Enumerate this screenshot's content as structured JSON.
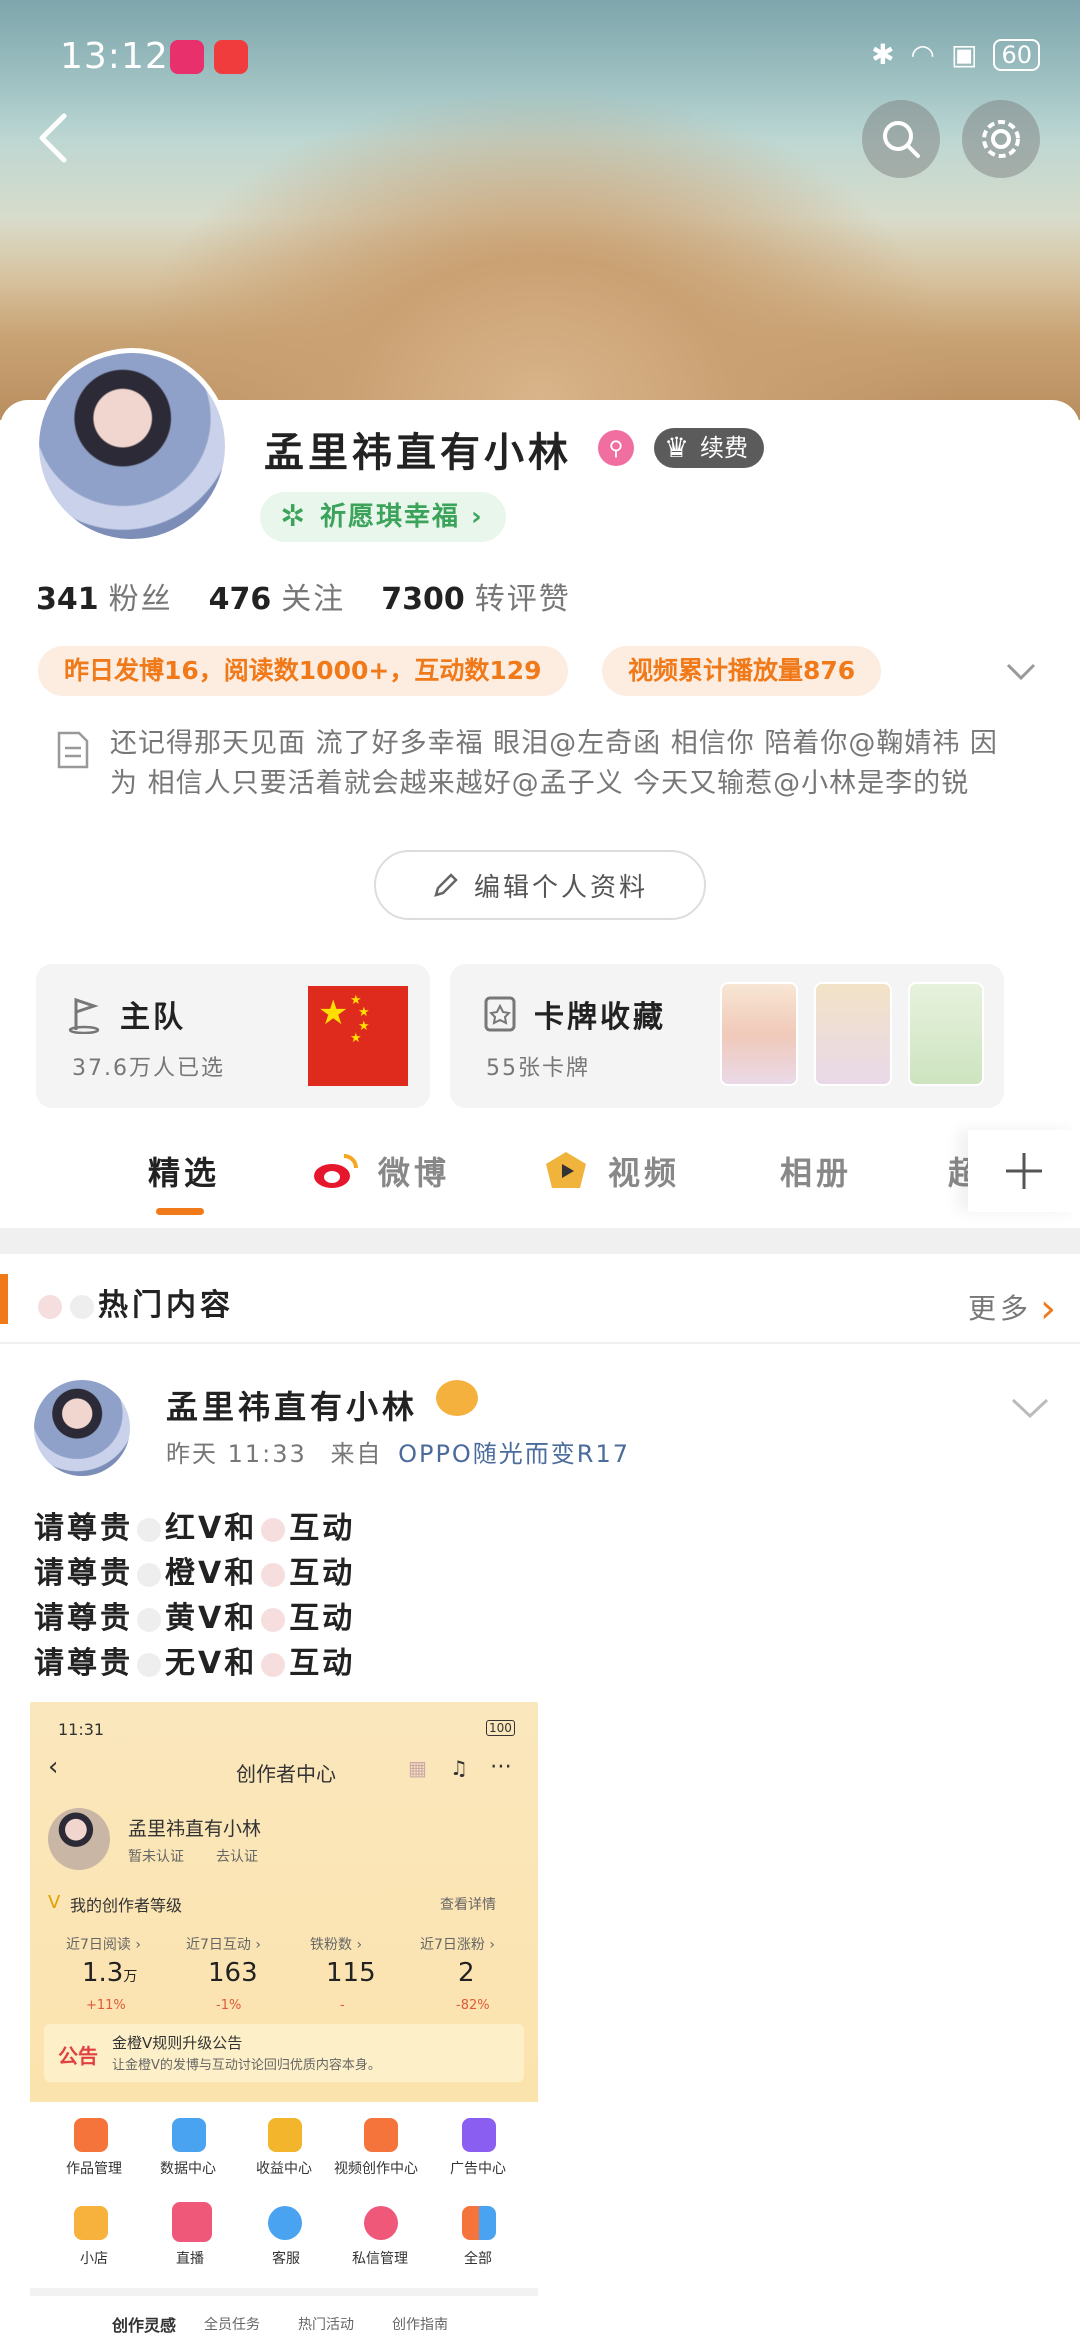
{
  "status_bar": {
    "time": "13:12",
    "battery": "60"
  },
  "profile": {
    "name": "孟里祎直有小林",
    "vip_label": "续费",
    "wish_label": "祈愿琪幸福 ›",
    "stats": [
      {
        "value": "341",
        "label": "粉丝"
      },
      {
        "value": "476",
        "label": "关注"
      },
      {
        "value": "7300",
        "label": "转评赞"
      }
    ],
    "pills": [
      "昨日发博16，阅读数1000+，互动数129",
      "视频累计播放量876"
    ],
    "bio": "还记得那天见面  流了好多幸福  眼泪@左奇函 相信你 陪着你@鞠婧祎 因为  相信人只要活着就会越来越好@孟子义 今天又输惹@小林是李的锐",
    "edit_label": "编辑个人资料"
  },
  "cards": {
    "team": {
      "title": "主队",
      "sub": "37.6万人已选"
    },
    "collection": {
      "title": "卡牌收藏",
      "sub": "55张卡牌"
    }
  },
  "tabs": [
    "精选",
    "微博",
    "视频",
    "相册",
    "超"
  ],
  "hot": {
    "title": "热门内容",
    "more": "更多"
  },
  "post": {
    "author": "孟里祎直有小林",
    "time": "昨天 11:33",
    "from_label": "来自",
    "source": "OPPO随光而变R17",
    "lines": [
      {
        "a": "请尊贵",
        "b": "红V和",
        "c": "互动"
      },
      {
        "a": "请尊贵",
        "b": "橙V和",
        "c": "互动"
      },
      {
        "a": "请尊贵",
        "b": "黄V和",
        "c": "互动"
      },
      {
        "a": "请尊贵",
        "b": "无V和",
        "c": "互动"
      }
    ]
  },
  "embedded": {
    "time": "11:31",
    "battery": "100",
    "title": "创作者中心",
    "user": "孟里祎直有小林",
    "cert": "暂未认证",
    "cert_link": "去认证",
    "level_label": "我的创作者等级",
    "detail_label": "查看详情",
    "metrics": [
      {
        "label": "近7日阅读 ›",
        "value": "1.3",
        "unit": "万",
        "delta": "+11%"
      },
      {
        "label": "近7日互动 ›",
        "value": "163",
        "unit": "",
        "delta": "-1%"
      },
      {
        "label": "铁粉数 ›",
        "value": "115",
        "unit": "",
        "delta": "-"
      },
      {
        "label": "近7日涨粉 ›",
        "value": "2",
        "unit": "",
        "delta": "-82%"
      }
    ],
    "notice_tag": "公告",
    "notice_title": "金橙V规则升级公告",
    "notice_body": "让金橙V的发博与互动讨论回归优质内容本身。",
    "grid": [
      "作品管理",
      "数据中心",
      "收益中心",
      "视频创作中心",
      "广告中心",
      "小店",
      "直播",
      "客服",
      "私信管理",
      "全部"
    ],
    "bottom_tabs": [
      "创作灵感",
      "全员任务",
      "热门活动",
      "创作指南"
    ]
  },
  "colors": {
    "accent": "#f07a1a",
    "wish_green": "#3ca35b",
    "link_blue": "#4a6b9b"
  }
}
